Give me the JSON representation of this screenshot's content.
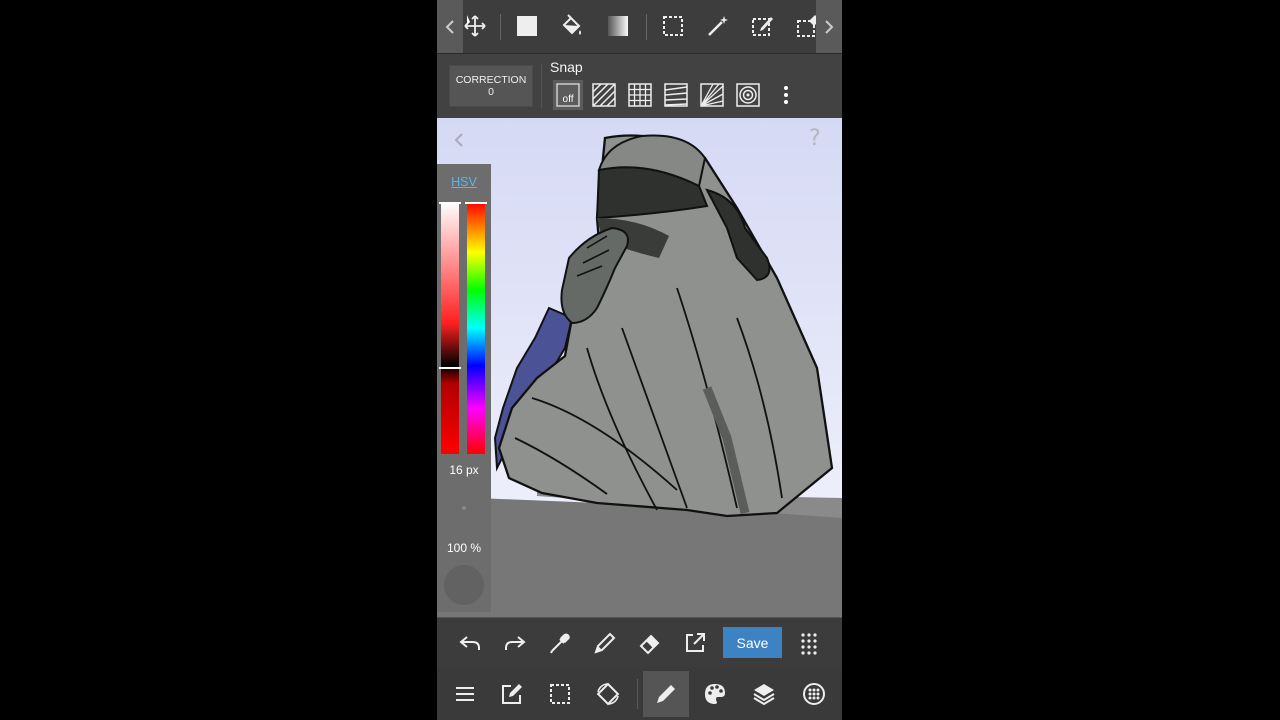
{
  "top_toolbar": {
    "tools": [
      "move-tool",
      "fill-rect-tool",
      "bucket-tool",
      "gradient-tool",
      "select-tool",
      "magic-wand-tool",
      "select-pen-tool",
      "select-eraser-tool"
    ]
  },
  "snap_bar": {
    "correction_label": "CORRECTION",
    "correction_value": "0",
    "snap_label": "Snap",
    "off_label": "off",
    "snap_modes": [
      "off",
      "parallel",
      "grid",
      "perspective-lines",
      "radial-lines",
      "concentric-circles"
    ]
  },
  "color_panel": {
    "mode_label": "HSV",
    "brush_size": "16 px",
    "opacity": "100 %"
  },
  "canvas": {
    "help_label": "?"
  },
  "action_bar": {
    "save_label": "Save"
  },
  "colors": {
    "accent": "#3d83c4",
    "hsv_link": "#5ab4f0",
    "toolbar_bg": "#3d3d3d"
  }
}
